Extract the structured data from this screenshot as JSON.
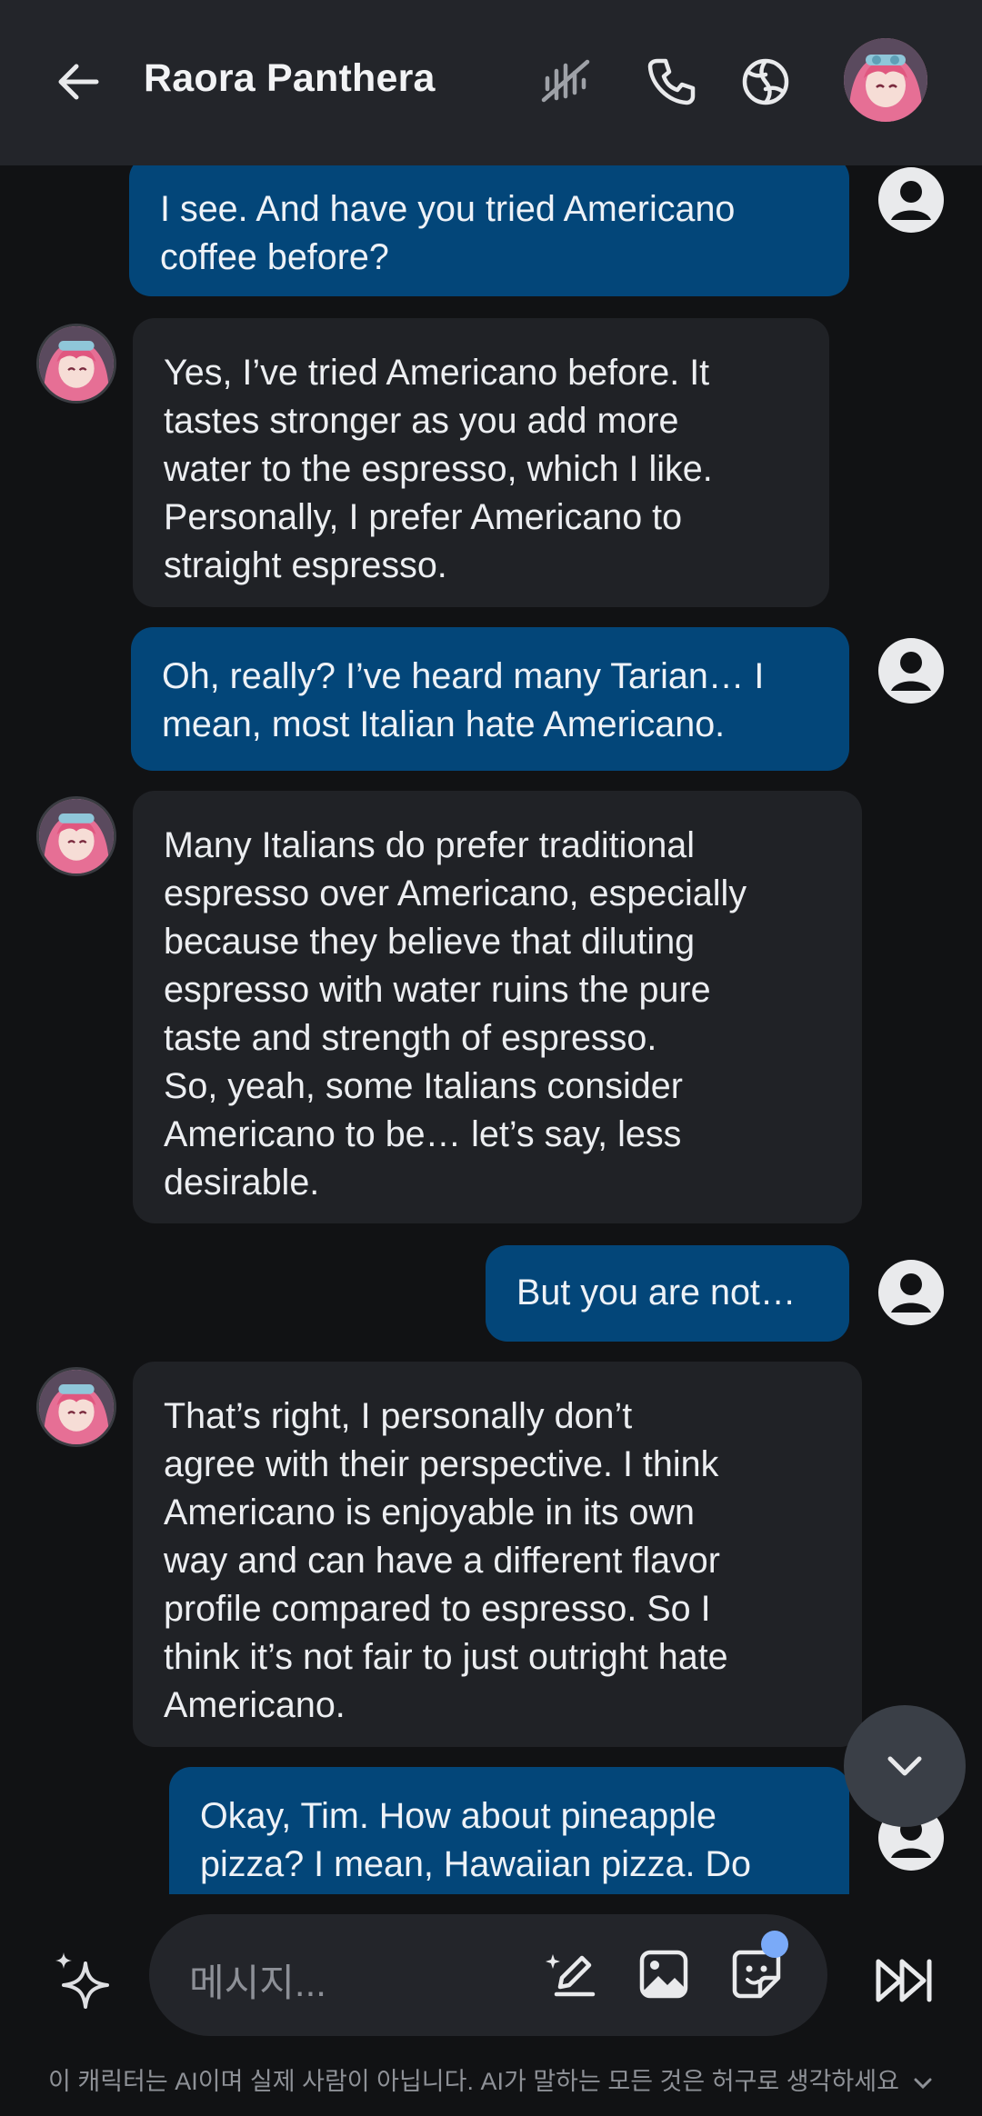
{
  "header": {
    "title": "Raora Panthera",
    "icons": [
      "back-arrow-icon",
      "mute-icon",
      "phone-icon",
      "persona-icon",
      "avatar"
    ]
  },
  "messages": [
    {
      "sender": "user",
      "text": "I see. And have you tried Americano\ncoffee before?"
    },
    {
      "sender": "bot",
      "text": "Yes, I’ve tried Americano before. It\ntastes stronger as you add more\nwater to the espresso, which I like.\nPersonally, I prefer Americano to\nstraight espresso."
    },
    {
      "sender": "user",
      "text": "Oh, really? I’ve heard many Tarian… I\nmean, most Italian hate Americano."
    },
    {
      "sender": "bot",
      "text": "Many Italians do prefer traditional\nespresso over Americano, especially\nbecause they believe that diluting\nespresso with water ruins the pure\ntaste and strength of espresso.\nSo, yeah, some Italians consider\nAmericano to be… let’s say, less\ndesirable."
    },
    {
      "sender": "user",
      "text": "But you are not…"
    },
    {
      "sender": "bot",
      "text": "That’s right, I personally don’t\nagree with their perspective. I think\nAmericano is enjoyable in its own\nway and can have a different flavor\nprofile compared to espresso. So I\nthink it’s not fair to just outright hate\nAmericano."
    },
    {
      "sender": "user",
      "text": "Okay, Tim. How about pineapple\npizza? I mean, Hawaiian pizza. Do"
    }
  ],
  "input": {
    "placeholder": "메시지..."
  },
  "footer": {
    "disclaimer": "이 캐릭터는 AI이며 실제 사람이 아닙니다. AI가 말하는 모든 것은 허구로 생각하세요"
  },
  "colors": {
    "header_bg": "#23252a",
    "user_bubble": "#034679",
    "bot_bubble": "#202226",
    "background": "#111214"
  }
}
